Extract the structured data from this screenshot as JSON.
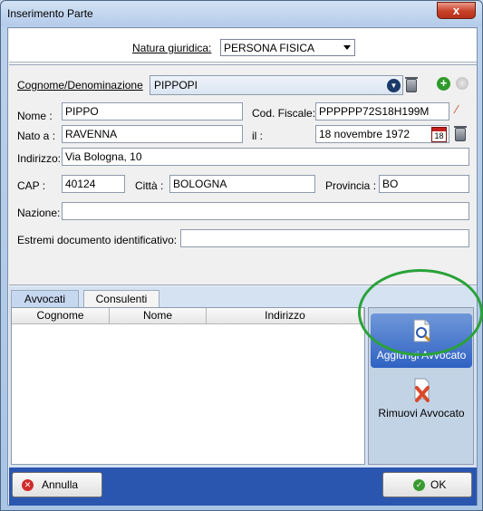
{
  "window": {
    "title": "Inserimento Parte",
    "close_symbol": "x"
  },
  "natura": {
    "label": "Natura giuridica:",
    "selected": "PERSONA FISICA"
  },
  "form": {
    "cognome_label": "Cognome/Denominazione",
    "cognome_value": "PIPPOPI",
    "nome_label": "Nome :",
    "nome_value": "PIPPO",
    "cf_label": "Cod. Fiscale:",
    "cf_value": "PPPPPP72S18H199M",
    "nato_label": "Nato a :",
    "nato_value": "RAVENNA",
    "il_label": "il :",
    "il_value": "18 novembre 1972",
    "calendar_day": "18",
    "indirizzo_label": "Indirizzo:",
    "indirizzo_value": "Via Bologna, 10",
    "cap_label": "CAP :",
    "cap_value": "40124",
    "citta_label": "Città :",
    "citta_value": "BOLOGNA",
    "provincia_label": "Provincia :",
    "provincia_value": "BO",
    "nazione_label": "Nazione:",
    "nazione_value": "",
    "estremi_label": "Estremi documento identificativo:",
    "estremi_value": ""
  },
  "tabs": [
    {
      "label": "Avvocati",
      "active": true
    },
    {
      "label": "Consulenti",
      "active": false
    }
  ],
  "grid": {
    "columns": [
      "Cognome",
      "Nome",
      "Indirizzo"
    ]
  },
  "side_actions": {
    "add_label": "Aggiungi Avvocato",
    "remove_label": "Rimuovi Avvocato"
  },
  "footer": {
    "cancel_label": "Annulla",
    "ok_label": "OK"
  },
  "colors": {
    "accent": "#2a56b0",
    "highlight_ring": "#2aa23a",
    "ok_icon": "#3a9a32",
    "cancel_icon": "#d02c2c"
  }
}
